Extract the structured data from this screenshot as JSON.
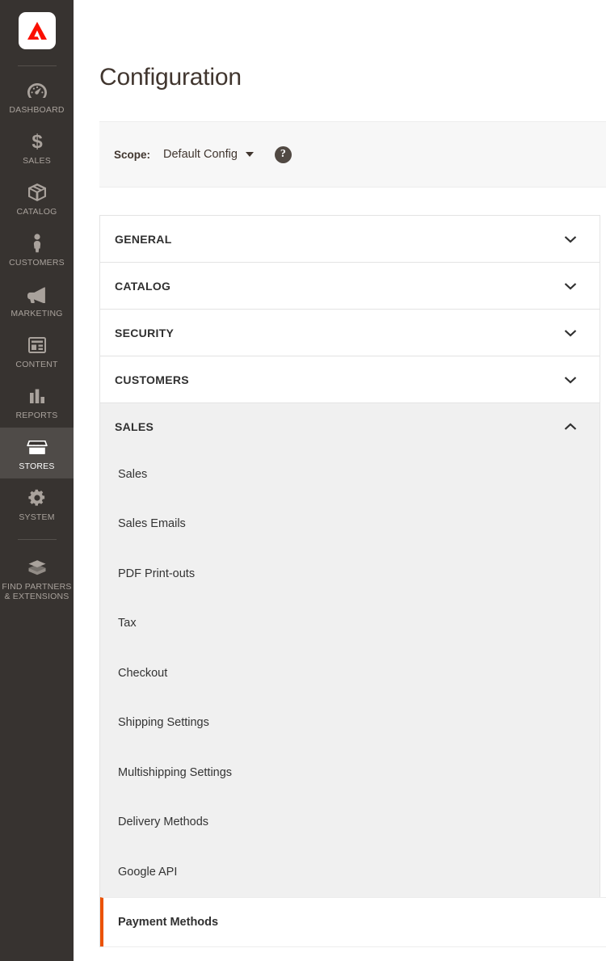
{
  "sidebar": {
    "logo": {
      "name": "adobe-commerce-logo",
      "color": "#fa0f00"
    },
    "items": [
      {
        "id": "dashboard",
        "label": "DASHBOARD",
        "icon": "gauge-icon",
        "active": false
      },
      {
        "id": "sales",
        "label": "SALES",
        "icon": "dollar-icon",
        "active": false
      },
      {
        "id": "catalog",
        "label": "CATALOG",
        "icon": "box-icon",
        "active": false
      },
      {
        "id": "customers",
        "label": "CUSTOMERS",
        "icon": "person-icon",
        "active": false
      },
      {
        "id": "marketing",
        "label": "MARKETING",
        "icon": "megaphone-icon",
        "active": false
      },
      {
        "id": "content",
        "label": "CONTENT",
        "icon": "layout-icon",
        "active": false
      },
      {
        "id": "reports",
        "label": "REPORTS",
        "icon": "bar-chart-icon",
        "active": false
      },
      {
        "id": "stores",
        "label": "STORES",
        "icon": "storefront-icon",
        "active": true
      },
      {
        "id": "system",
        "label": "SYSTEM",
        "icon": "gear-icon",
        "active": false
      },
      {
        "id": "find-partners",
        "label": "FIND PARTNERS\n& EXTENSIONS",
        "icon": "extension-icon",
        "active": false
      }
    ]
  },
  "header": {
    "title": "Configuration"
  },
  "scope": {
    "label": "Scope:",
    "value": "Default Config",
    "help_glyph": "?",
    "options": [
      "Default Config"
    ]
  },
  "accordion": {
    "sections": [
      {
        "id": "general",
        "label": "GENERAL",
        "expanded": false
      },
      {
        "id": "catalog",
        "label": "CATALOG",
        "expanded": false
      },
      {
        "id": "security",
        "label": "SECURITY",
        "expanded": false
      },
      {
        "id": "customers",
        "label": "CUSTOMERS",
        "expanded": false
      },
      {
        "id": "sales",
        "label": "SALES",
        "expanded": true
      }
    ],
    "sales_items": [
      {
        "id": "sales",
        "label": "Sales",
        "current": false
      },
      {
        "id": "sales-emails",
        "label": "Sales Emails",
        "current": false
      },
      {
        "id": "pdf-print-outs",
        "label": "PDF Print-outs",
        "current": false
      },
      {
        "id": "tax",
        "label": "Tax",
        "current": false
      },
      {
        "id": "checkout",
        "label": "Checkout",
        "current": false
      },
      {
        "id": "shipping-settings",
        "label": "Shipping Settings",
        "current": false
      },
      {
        "id": "multishipping-settings",
        "label": "Multishipping Settings",
        "current": false
      },
      {
        "id": "delivery-methods",
        "label": "Delivery Methods",
        "current": false
      },
      {
        "id": "google-api",
        "label": "Google API",
        "current": false
      },
      {
        "id": "payment-methods",
        "label": "Payment Methods",
        "current": true
      }
    ]
  },
  "colors": {
    "sidebar_bg": "#373330",
    "sidebar_active_bg": "#4f4b48",
    "accent_orange": "#eb5202",
    "panel_gray": "#f0f0f0",
    "scope_bar_bg": "#f7f7f7",
    "text_dark": "#303030"
  }
}
